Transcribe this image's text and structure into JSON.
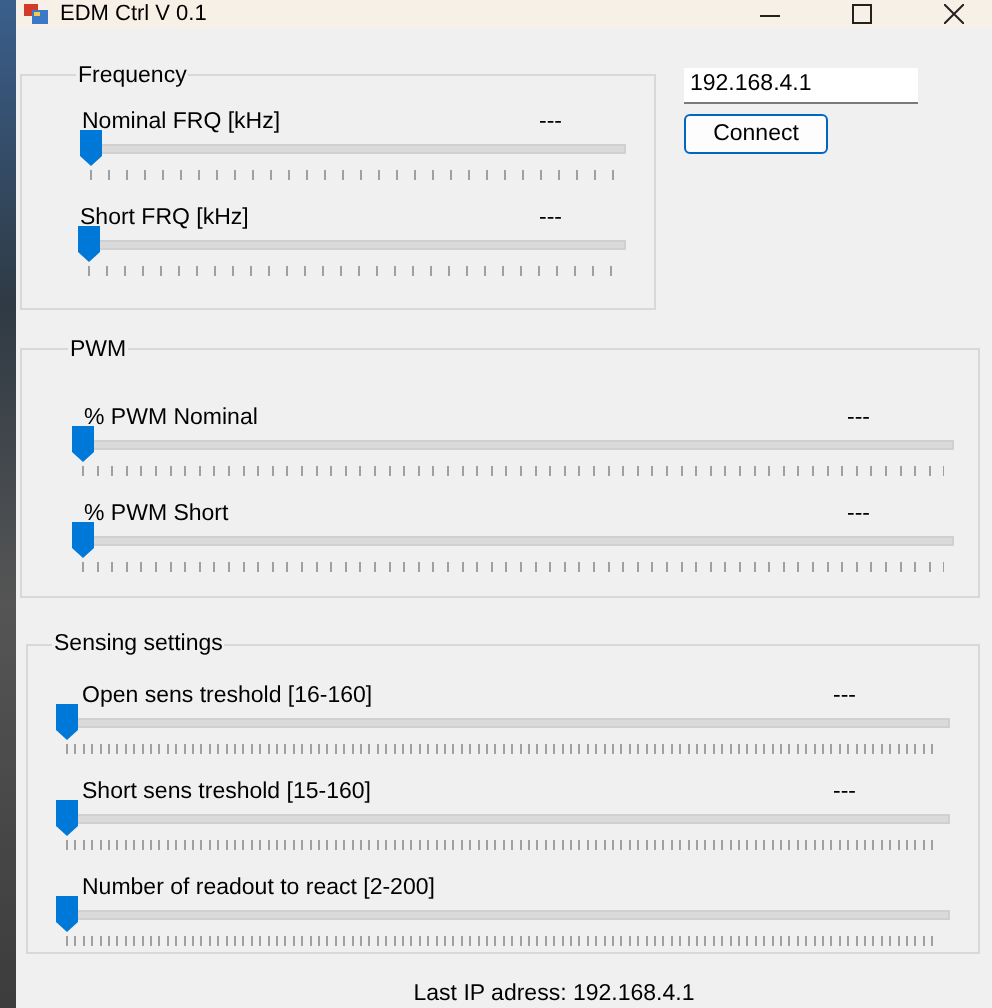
{
  "window": {
    "title": "EDM Ctrl V 0.1"
  },
  "groups": [
    {
      "title": "Frequency",
      "sliders": [
        {
          "label": "Nominal FRQ [kHz]",
          "value": "---",
          "level": 0
        },
        {
          "label": "Short FRQ [kHz]",
          "value": "---",
          "level": 0
        }
      ]
    },
    {
      "title": "PWM",
      "sliders": [
        {
          "label": "% PWM Nominal",
          "value": "---",
          "level": 0
        },
        {
          "label": "% PWM Short",
          "value": "---",
          "level": 0
        }
      ]
    },
    {
      "title": "Sensing settings",
      "sliders": [
        {
          "label": "Open sens treshold [16-160]",
          "value": "---",
          "level": 0
        },
        {
          "label": "Short sens treshold [15-160]",
          "value": "---",
          "level": 0
        },
        {
          "label": "Number of readout to react [2-200]",
          "level": 0
        }
      ]
    }
  ],
  "ip_field": {
    "value": "192.168.4.1"
  },
  "connect_button": "Connect",
  "status": "Last IP adress: 192.168.4.1"
}
